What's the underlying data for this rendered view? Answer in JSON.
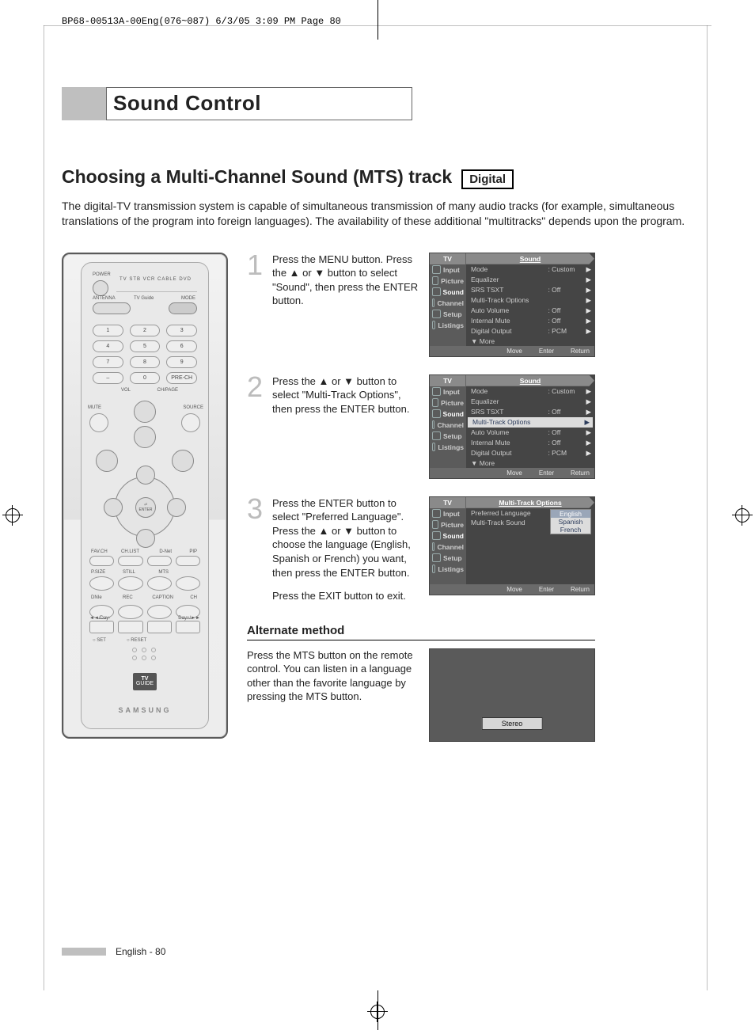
{
  "print_info": "BP68-00513A-00Eng(076~087)  6/3/05  3:09 PM  Page 80",
  "section_title": "Sound Control",
  "subhead": "Choosing a Multi-Channel Sound (MTS) track",
  "subhead_tag": "Digital",
  "intro_para": "The digital-TV transmission system is capable of simultaneous transmission of many audio tracks (for example, simultaneous translations of the program into foreign languages). The availability of these additional \"multitracks\" depends upon the program.",
  "remote": {
    "labels": {
      "power": "POWER",
      "mode_row": "TV  STB  VCR  CABLE  DVD",
      "antenna": "ANTENNA",
      "tvguide": "TV Guide",
      "mode": "MODE",
      "vol": "VOL",
      "chpage": "CH/PAGE",
      "mute": "MUTE",
      "source": "SOURCE",
      "enter": "ENTER",
      "favch": "FAV.CH",
      "chlist": "CH.LIST",
      "dnet": "D-Net",
      "pip": "PIP",
      "psize": "P.SIZE",
      "still": "STILL",
      "mts": "MTS",
      "dnie": "DNIe",
      "rec": "REC",
      "caption": "CAPTION",
      "ch": "CH",
      "day": "◄◄/Day-",
      "dayp": "Day+/►►",
      "set": "○ SET",
      "reset": "○ RESET",
      "brand": "SAMSUNG",
      "tvg1": "TV",
      "tvg2": "GUIDE",
      "prech": "PRE-CH"
    },
    "numbers": [
      "1",
      "2",
      "3",
      "4",
      "5",
      "6",
      "7",
      "8",
      "9",
      "–",
      "0"
    ]
  },
  "steps": [
    {
      "num": "1",
      "text": "Press the MENU button. Press the ▲ or ▼ button to select \"Sound\", then press the ENTER button."
    },
    {
      "num": "2",
      "text": "Press the ▲ or ▼ button to select \"Multi-Track Options\", then press the ENTER button."
    },
    {
      "num": "3",
      "text": "Press the ENTER button to select \"Preferred Language\". Press the ▲ or ▼ button to choose the language (English, Spanish or French) you want, then press the ENTER button.",
      "after": "Press the EXIT button to exit."
    }
  ],
  "osd_common": {
    "tv": "TV",
    "side": [
      "Input",
      "Picture",
      "Sound",
      "Channel",
      "Setup",
      "Listings"
    ],
    "foot_move": "Move",
    "foot_enter": "Enter",
    "foot_return": "Return"
  },
  "osd1": {
    "title": "Sound",
    "rows": [
      {
        "k": "Mode",
        "v": ": Custom",
        "arr": "▶"
      },
      {
        "k": "Equalizer",
        "v": "",
        "arr": "▶"
      },
      {
        "k": "SRS TSXT",
        "v": ": Off",
        "arr": "▶"
      },
      {
        "k": "Multi-Track Options",
        "v": "",
        "arr": "▶"
      },
      {
        "k": "Auto Volume",
        "v": ": Off",
        "arr": "▶"
      },
      {
        "k": "Internal Mute",
        "v": ": Off",
        "arr": "▶"
      },
      {
        "k": "Digital Output",
        "v": ": PCM",
        "arr": "▶"
      },
      {
        "k": "▼ More",
        "v": "",
        "arr": ""
      }
    ],
    "highlight_side": "Sound"
  },
  "osd2": {
    "title": "Sound",
    "rows": [
      {
        "k": "Mode",
        "v": ": Custom",
        "arr": "▶"
      },
      {
        "k": "Equalizer",
        "v": "",
        "arr": "▶"
      },
      {
        "k": "SRS TSXT",
        "v": ": Off",
        "arr": "▶"
      },
      {
        "k": "Multi-Track Options",
        "v": "",
        "arr": "▶",
        "sel": true
      },
      {
        "k": "Auto Volume",
        "v": ": Off",
        "arr": "▶"
      },
      {
        "k": "Internal Mute",
        "v": ": Off",
        "arr": "▶"
      },
      {
        "k": "Digital Output",
        "v": ": PCM",
        "arr": "▶"
      },
      {
        "k": "▼ More",
        "v": "",
        "arr": ""
      }
    ],
    "highlight_side": "Sound"
  },
  "osd3": {
    "title": "Multi-Track Options",
    "rows": [
      {
        "k": "Preferred Language",
        "v": "",
        "arr": ""
      },
      {
        "k": "Multi-Track Sound",
        "v": "",
        "arr": ""
      }
    ],
    "lang_options": [
      "English",
      "Spanish",
      "French"
    ],
    "lang_selected": "English",
    "highlight_side": "Sound"
  },
  "alternate": {
    "head": "Alternate method",
    "text": "Press the MTS button on the remote control. You can listen in a language other than the favorite language by pressing the MTS button.",
    "stereo": "Stereo"
  },
  "footer": "English - 80"
}
